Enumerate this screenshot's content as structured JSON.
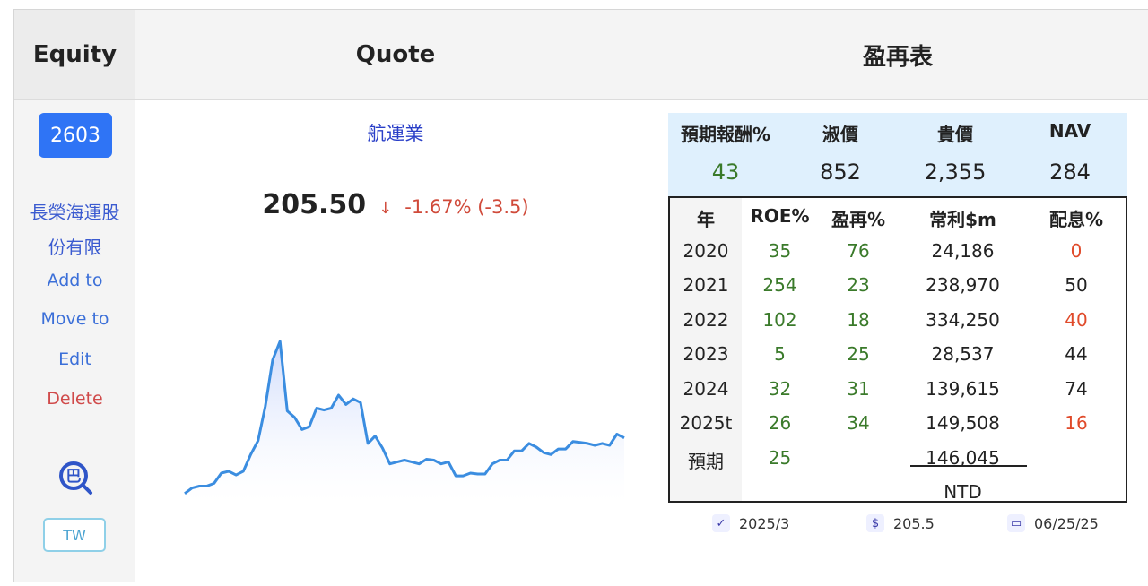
{
  "header": {
    "equity": "Equity",
    "quote": "Quote",
    "table": "盈再表"
  },
  "sidebar": {
    "ticker": "2603",
    "company_line1": "長榮海運股",
    "company_line2": "份有限",
    "actions": {
      "add_to": "Add to",
      "move_to": "Move to",
      "edit": "Edit",
      "delete": "Delete"
    },
    "search_glyph": "巴",
    "market": "TW"
  },
  "quote": {
    "sector": "航運業",
    "price": "205.50",
    "arrow": "↓",
    "change": "-1.67% (-3.5)",
    "colors": {
      "down": "#d04a3a",
      "line": "#3b8de0"
    }
  },
  "chart_data": {
    "type": "area",
    "values": [
      6,
      12,
      14,
      14,
      17,
      28,
      30,
      26,
      30,
      48,
      63,
      100,
      150,
      170,
      95,
      88,
      75,
      78,
      98,
      96,
      98,
      112,
      102,
      108,
      104,
      60,
      68,
      55,
      38,
      40,
      42,
      40,
      38,
      43,
      42,
      38,
      40,
      25,
      25,
      28,
      27,
      27,
      38,
      42,
      42,
      52,
      52,
      60,
      56,
      50,
      48,
      54,
      54,
      62,
      61,
      60,
      58,
      60,
      58,
      70,
      66
    ]
  },
  "eval": {
    "labels": [
      "預期報酬%",
      "淑價",
      "貴價",
      "NAV"
    ],
    "values": [
      "43",
      "852",
      "2,355",
      "284"
    ]
  },
  "fin": {
    "headers": [
      "年",
      "ROE%",
      "盈再%",
      "常利$m",
      "配息%"
    ],
    "rows": [
      [
        "2020",
        "35",
        "76",
        "24,186",
        "0"
      ],
      [
        "2021",
        "254",
        "23",
        "238,970",
        "50"
      ],
      [
        "2022",
        "102",
        "18",
        "334,250",
        "40"
      ],
      [
        "2023",
        "5",
        "25",
        "28,537",
        "44"
      ],
      [
        "2024",
        "32",
        "31",
        "139,615",
        "74"
      ],
      [
        "2025t",
        "26",
        "34",
        "149,508",
        "16"
      ]
    ],
    "forecast": {
      "label": "預期",
      "roe": "25",
      "profit": "146,045"
    },
    "currency": "NTD"
  },
  "footer": {
    "period": "2025/3",
    "price_icon": "$",
    "price": "205.5",
    "date": "06/25/25"
  }
}
